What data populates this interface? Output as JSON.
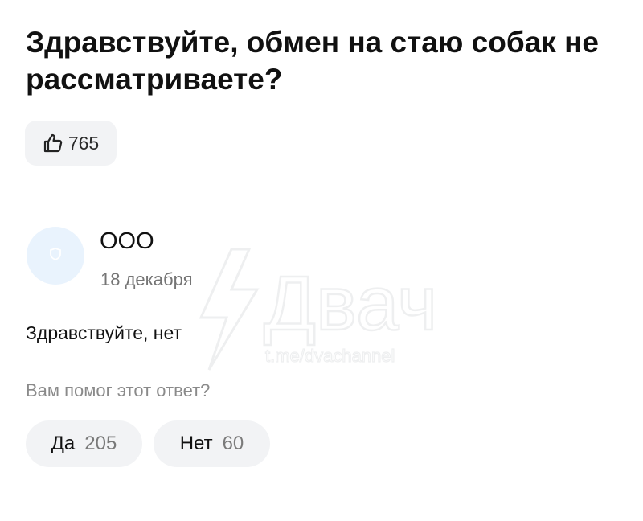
{
  "question": {
    "title": "Здравствуйте, обмен на стаю собак не рассматриваете?",
    "likes": "765"
  },
  "answer": {
    "author": "ООО",
    "date": "18 декабря",
    "text": "Здравствуйте, нет"
  },
  "feedback": {
    "prompt": "Вам помог этот ответ?",
    "yes_label": "Да",
    "yes_count": "205",
    "no_label": "Нет",
    "no_count": "60"
  },
  "watermark": {
    "logo_text": "Двач",
    "url": "t.me/dvachannel"
  },
  "icons": {
    "like": "thumbs-up-icon",
    "avatar": "shield-icon"
  },
  "colors": {
    "background": "#ffffff",
    "button_bg": "#f2f3f5",
    "avatar_bg": "#e9f3fd",
    "muted_text": "#8a8a8a"
  }
}
